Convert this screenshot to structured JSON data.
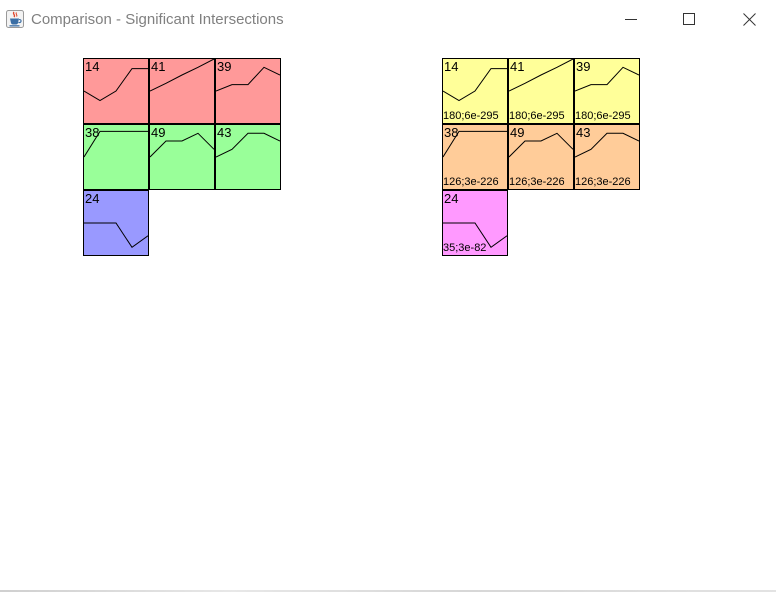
{
  "window": {
    "title": "Comparison - Significant Intersections",
    "app_icon": "java-cup-icon",
    "controls": [
      "minimize-icon",
      "maximize-icon",
      "close-icon"
    ]
  },
  "colors": {
    "red": "#ff9999",
    "green": "#99ff99",
    "blue": "#9999ff",
    "yellow": "#ffff99",
    "orange": "#ffcc99",
    "pink": "#ff99ff"
  },
  "left_panel": {
    "tiles": [
      {
        "id": "14",
        "color": "red",
        "profile": [
          0.5,
          0.35,
          0.5,
          0.85,
          0.85
        ]
      },
      {
        "id": "41",
        "color": "red",
        "profile": [
          0.5,
          0.62,
          0.75,
          0.87,
          1.0
        ]
      },
      {
        "id": "39",
        "color": "red",
        "profile": [
          0.5,
          0.6,
          0.6,
          0.87,
          0.75
        ]
      },
      {
        "id": "38",
        "color": "green",
        "profile": [
          0.5,
          0.9,
          0.9,
          0.9,
          0.9
        ]
      },
      {
        "id": "49",
        "color": "green",
        "profile": [
          0.5,
          0.75,
          0.75,
          0.87,
          0.62
        ]
      },
      {
        "id": "43",
        "color": "green",
        "profile": [
          0.5,
          0.62,
          0.87,
          0.87,
          0.75
        ]
      },
      {
        "id": "24",
        "color": "blue",
        "profile": [
          0.5,
          0.5,
          0.5,
          0.12,
          0.3
        ]
      }
    ]
  },
  "right_panel": {
    "tiles": [
      {
        "id": "14",
        "stat": "180;6e-295",
        "color": "yellow",
        "profile": [
          0.5,
          0.35,
          0.5,
          0.85,
          0.85
        ]
      },
      {
        "id": "41",
        "stat": "180;6e-295",
        "color": "yellow",
        "profile": [
          0.5,
          0.62,
          0.75,
          0.87,
          1.0
        ]
      },
      {
        "id": "39",
        "stat": "180;6e-295",
        "color": "yellow",
        "profile": [
          0.5,
          0.6,
          0.6,
          0.87,
          0.75
        ]
      },
      {
        "id": "38",
        "stat": "126;3e-226",
        "color": "orange",
        "profile": [
          0.5,
          0.9,
          0.9,
          0.9,
          0.9
        ]
      },
      {
        "id": "49",
        "stat": "126;3e-226",
        "color": "orange",
        "profile": [
          0.5,
          0.75,
          0.75,
          0.87,
          0.62
        ]
      },
      {
        "id": "43",
        "stat": "126;3e-226",
        "color": "orange",
        "profile": [
          0.5,
          0.62,
          0.87,
          0.87,
          0.75
        ]
      },
      {
        "id": "24",
        "stat": "35;3e-82",
        "color": "pink",
        "profile": [
          0.5,
          0.5,
          0.5,
          0.12,
          0.3
        ]
      }
    ]
  }
}
